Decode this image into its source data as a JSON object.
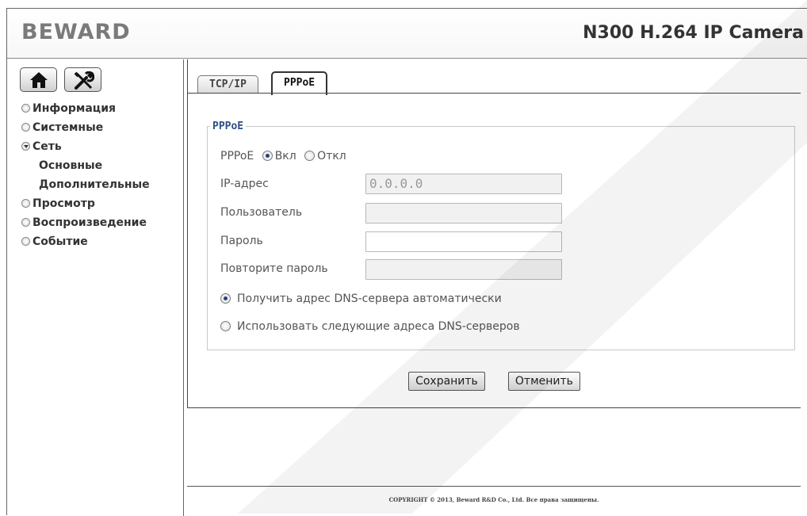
{
  "header": {
    "logo": "BEWARD",
    "product": "N300 H.264 IP Camera"
  },
  "sidebar": {
    "icons": [
      "home-icon",
      "tools-icon"
    ],
    "items": [
      {
        "label": "Информация",
        "state": "closed"
      },
      {
        "label": "Системные",
        "state": "closed"
      },
      {
        "label": "Сеть",
        "state": "open",
        "children": [
          "Основные",
          "Дополнительные"
        ]
      },
      {
        "label": "Просмотр",
        "state": "closed"
      },
      {
        "label": "Воспроизведение",
        "state": "closed"
      },
      {
        "label": "Событие",
        "state": "closed"
      }
    ]
  },
  "tabs": [
    {
      "label": "TCP/IP",
      "active": false
    },
    {
      "label": "PPPoE",
      "active": true
    }
  ],
  "form": {
    "legend": "PPPoE",
    "pppoe_label": "PPPoE",
    "on_label": "Вкл",
    "off_label": "Откл",
    "pppoe_selected": "on",
    "ip_label": "IP-адрес",
    "ip_value": "0.0.0.0",
    "user_label": "Пользователь",
    "user_value": "",
    "password_label": "Пароль",
    "password_value": "",
    "repeat_label": "Повторите пароль",
    "repeat_value": "",
    "dns_auto_label": "Получить адрес DNS-сервера автоматически",
    "dns_manual_label": "Использовать следующие адреса DNS-серверов",
    "dns_selected": "auto"
  },
  "actions": {
    "save": "Сохранить",
    "cancel": "Отменить"
  },
  "footer": {
    "copyright": "COPYRIGHT © 2013, Beward R&D Co., Ltd. Все права защищены."
  }
}
